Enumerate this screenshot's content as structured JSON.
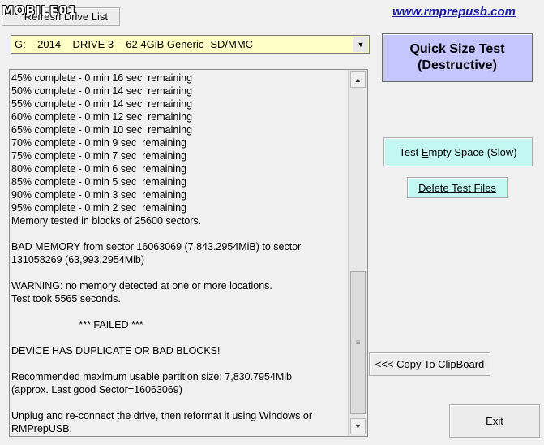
{
  "logo": {
    "text": "MOBILE01"
  },
  "toolbar": {
    "refresh_label": "Refresh Drive List",
    "site_link": "www.rmprepusb.com"
  },
  "drive": {
    "selected": "G:    2014    DRIVE 3 -  62.4GiB Generic- SD/MMC"
  },
  "buttons": {
    "quick_line1": "Quick Size Test",
    "quick_line2": "(Destructive)",
    "empty_pre": "Test ",
    "empty_acc": "E",
    "empty_post": "mpty Space (Slow)",
    "delete_label": "Delete Test Files",
    "copy_label": "<<< Copy To ClipBoard",
    "exit_acc": "E",
    "exit_post": "xit"
  },
  "log": {
    "text": "45% complete - 0 min 16 sec  remaining\n50% complete - 0 min 14 sec  remaining\n55% complete - 0 min 14 sec  remaining\n60% complete - 0 min 12 sec  remaining\n65% complete - 0 min 10 sec  remaining\n70% complete - 0 min 9 sec  remaining\n75% complete - 0 min 7 sec  remaining\n80% complete - 0 min 6 sec  remaining\n85% complete - 0 min 5 sec  remaining\n90% complete - 0 min 3 sec  remaining\n95% complete - 0 min 2 sec  remaining\nMemory tested in blocks of 25600 sectors.\n\nBAD MEMORY from sector 16063069 (7,843.2954MiB) to sector\n131058269 (63,993.2954Mib)\n\nWARNING: no memory detected at one or more locations.\nTest took 5565 seconds.\n\n                        *** FAILED ***\n\nDEVICE HAS DUPLICATE OR BAD BLOCKS!\n\nRecommended maximum usable partition size: 7,830.7954Mib\n(approx. Last good Sector=16063069)\n\nUnplug and re-connect the drive, then reformat it using Windows or\nRMPrepUSB."
  },
  "icons": {
    "dropdown": "chevron-down-icon",
    "scroll_up": "chevron-up-icon",
    "scroll_down": "chevron-down-icon",
    "grip": "grip-icon"
  },
  "colors": {
    "quick_button_bg": "#c6c6ff",
    "cyan_button_bg": "#c2f7f2",
    "drive_select_bg": "#ffffc6",
    "link": "#1a1aa6"
  }
}
